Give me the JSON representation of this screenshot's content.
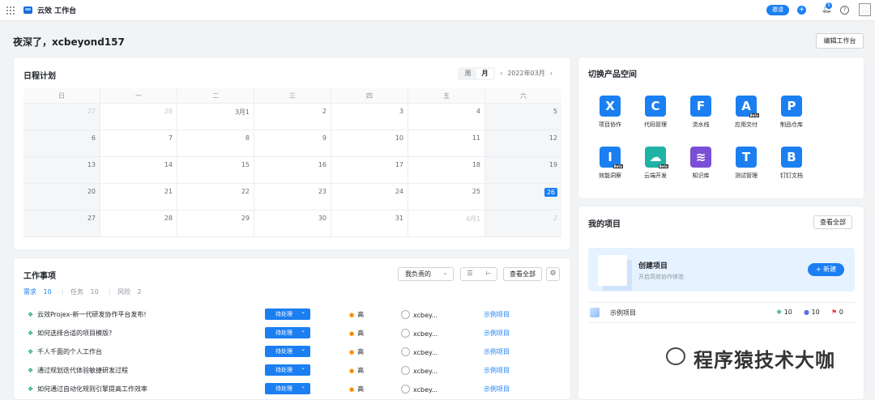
{
  "topbar": {
    "title": "云效 工作台",
    "invite": "邀请",
    "plus": "+",
    "bell_badge": "5",
    "help": "?"
  },
  "greeting": "夜深了，xcbeyond157",
  "edit_workbench": "编辑工作台",
  "schedule": {
    "title": "日程计划",
    "view_week": "周",
    "view_month": "月",
    "month_label": "2022年03月",
    "prev": "‹",
    "next": "›",
    "weekdays": [
      "日",
      "一",
      "二",
      "三",
      "四",
      "五",
      "六"
    ],
    "weeks": [
      [
        "27",
        "28",
        "3月1",
        "2",
        "3",
        "4",
        "5"
      ],
      [
        "6",
        "7",
        "8",
        "9",
        "10",
        "11",
        "12"
      ],
      [
        "13",
        "14",
        "15",
        "16",
        "17",
        "18",
        "19"
      ],
      [
        "20",
        "21",
        "22",
        "23",
        "24",
        "25",
        "26"
      ],
      [
        "27",
        "28",
        "29",
        "30",
        "31",
        "4月1",
        "2"
      ]
    ],
    "today": "26"
  },
  "work": {
    "title": "工作事项",
    "filter": "我负责的",
    "view_all": "查看全部",
    "tabs": [
      {
        "label": "需求",
        "count": "10"
      },
      {
        "label": "任务",
        "count": "10"
      },
      {
        "label": "风险",
        "count": "2"
      }
    ],
    "rows": [
      {
        "name": "云效Projex-新一代研发协作平台发布!",
        "status": "待处理",
        "priority": "高",
        "owner": "xcbey...",
        "project": "示例项目"
      },
      {
        "name": "如何选择合适的项目模版?",
        "status": "待处理",
        "priority": "高",
        "owner": "xcbey...",
        "project": "示例项目"
      },
      {
        "name": "千人千面的个人工作台",
        "status": "待处理",
        "priority": "高",
        "owner": "xcbey...",
        "project": "示例项目"
      },
      {
        "name": "通过规划迭代体验敏捷研发过程",
        "status": "待处理",
        "priority": "高",
        "owner": "xcbey...",
        "project": "示例项目"
      },
      {
        "name": "如何通过自动化规则引擎提高工作效率",
        "status": "待处理",
        "priority": "高",
        "owner": "xcbey...",
        "project": "示例项目"
      }
    ]
  },
  "products": {
    "title": "切换产品空间",
    "items": [
      {
        "label": "项目协作",
        "glyph": "X",
        "color": "#1b7ff2"
      },
      {
        "label": "代码管理",
        "glyph": "C",
        "color": "#1b7ff2"
      },
      {
        "label": "流水线",
        "glyph": "F",
        "color": "#1b7ff2"
      },
      {
        "label": "应用交付",
        "glyph": "A",
        "color": "#1b7ff2",
        "tag": "Beta"
      },
      {
        "label": "制品仓库",
        "glyph": "P",
        "color": "#1b7ff2"
      },
      {
        "label": "效能洞察",
        "glyph": "I",
        "color": "#1b7ff2",
        "tag": "Beta"
      },
      {
        "label": "云端开发",
        "glyph": "☁",
        "color": "#1fb3a6",
        "tag": "Beta"
      },
      {
        "label": "知识库",
        "glyph": "≋",
        "color": "#7a4fd6"
      },
      {
        "label": "测试管理",
        "glyph": "T",
        "color": "#1b7ff2"
      },
      {
        "label": "钉钉文档",
        "glyph": "B",
        "color": "#1b7ff2"
      }
    ]
  },
  "projects": {
    "title": "我的项目",
    "view_all": "查看全部",
    "create_title": "创建项目",
    "create_sub": "开启高效协作体验",
    "new_button": "+ 新建",
    "item": {
      "name": "示例项目",
      "req": "10",
      "task": "10",
      "risk": "0"
    }
  },
  "watermark": "程序猿技术大咖"
}
